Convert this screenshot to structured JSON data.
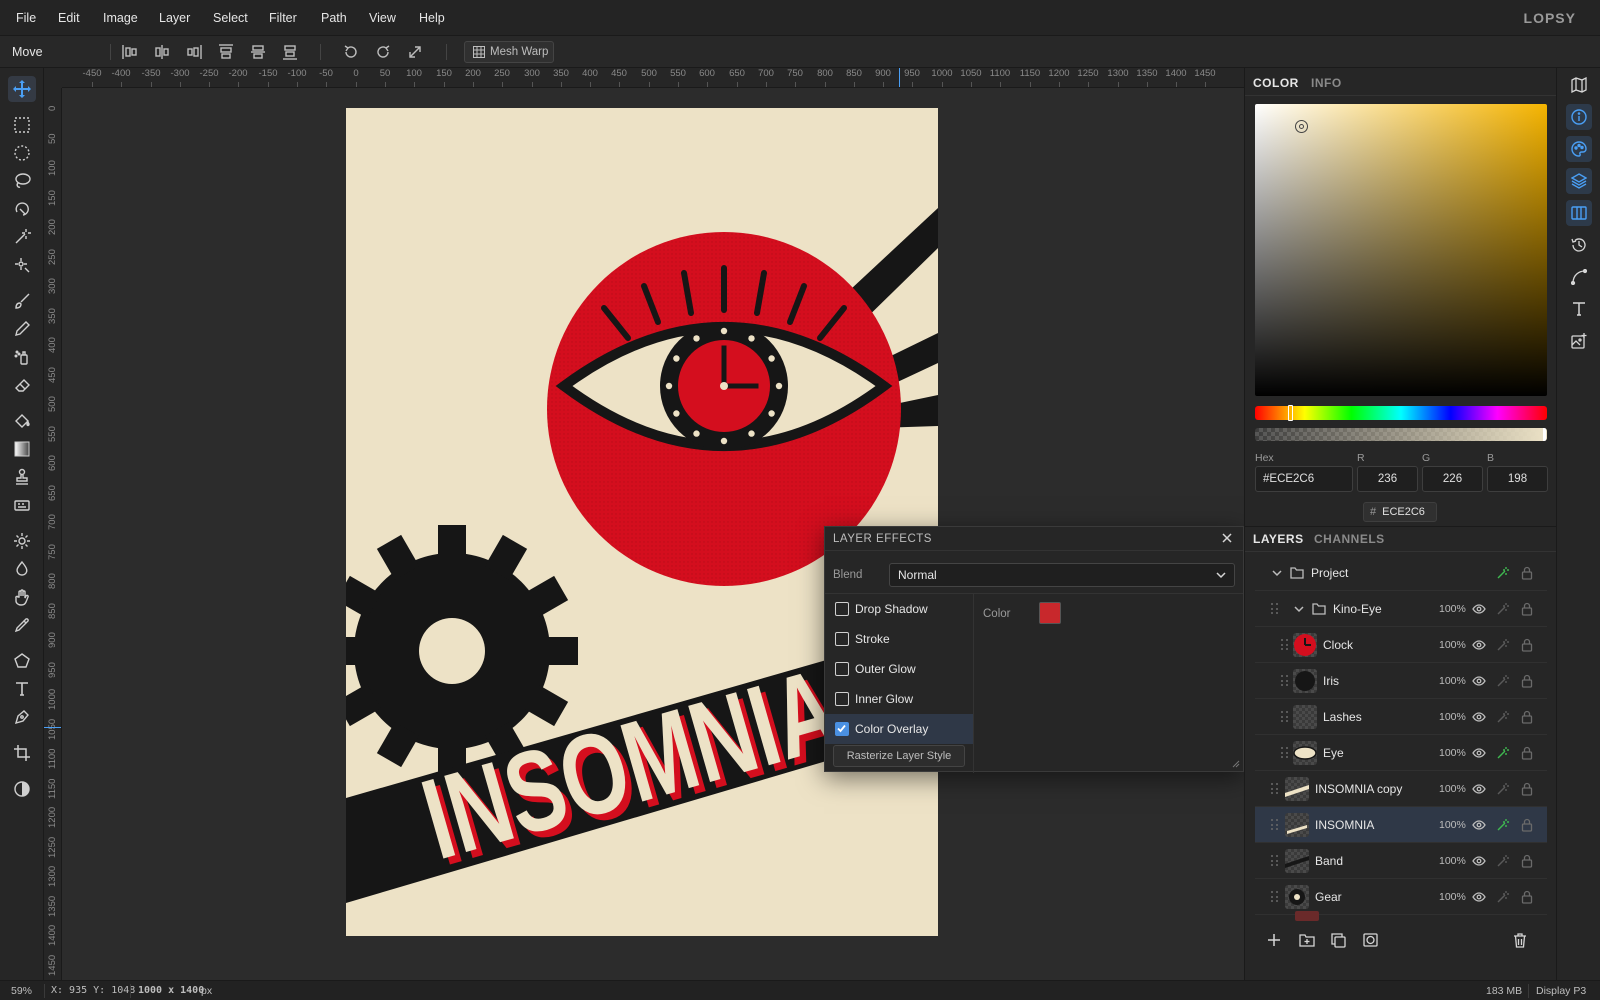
{
  "menubar": {
    "items": [
      "File",
      "Edit",
      "Image",
      "Layer",
      "Select",
      "Filter",
      "Path",
      "View",
      "Help"
    ],
    "brand": "LOPSY"
  },
  "options": {
    "tool_name": "Move",
    "mesh_warp_label": "Mesh Warp",
    "icons": [
      "align-left-icon",
      "align-center-h-icon",
      "align-right-icon",
      "align-top-icon",
      "align-middle-v-icon",
      "align-bottom-icon",
      "rotate-ccw-icon",
      "rotate-cw-icon",
      "expand-icon"
    ]
  },
  "rulers": {
    "horizontal": [
      "-450",
      "-400",
      "-350",
      "-300",
      "-250",
      "-200",
      "-150",
      "-100",
      "-50",
      "0",
      "50",
      "100",
      "150",
      "200",
      "250",
      "300",
      "350",
      "400",
      "450",
      "500",
      "550",
      "600",
      "650",
      "700",
      "750",
      "800",
      "850",
      "900",
      "950",
      "1000",
      "1050",
      "1100",
      "1150",
      "1200",
      "1250",
      "1300",
      "1350",
      "1400",
      "1450"
    ],
    "vertical": [
      "0",
      "50",
      "100",
      "150",
      "200",
      "250",
      "300",
      "350",
      "400",
      "450",
      "500",
      "550",
      "600",
      "650",
      "700",
      "750",
      "800",
      "850",
      "900",
      "950",
      "1000",
      "1050",
      "1100",
      "1150",
      "1200",
      "1250",
      "1300",
      "1350",
      "1400",
      "1450"
    ]
  },
  "toolbar": {
    "tools": [
      "move-tool",
      "rect-marquee-tool",
      "ellipse-marquee-tool",
      "lasso-tool",
      "magnetic-lasso-tool",
      "magic-wand-tool",
      "quick-select-tool",
      "brush-tool",
      "pencil-tool",
      "spray-tool",
      "eraser-tool",
      "fill-tool",
      "gradient-tool",
      "clone-stamp-tool",
      "pattern-tool",
      "dodge-tool",
      "burn-tool",
      "hand-tool",
      "eyedropper-tool",
      "polygon-tool",
      "text-tool",
      "pen-tool",
      "crop-tool",
      "contrast-tool"
    ],
    "active": "move-tool"
  },
  "artwork": {
    "banner_text": "INSOMNIA",
    "colors": {
      "paper": "#ede2c6",
      "red": "#d40e1e",
      "black": "#161616"
    }
  },
  "color_panel": {
    "tabs": [
      "COLOR",
      "INFO"
    ],
    "active_tab": "COLOR",
    "hex_label": "Hex",
    "r_label": "R",
    "g_label": "G",
    "b_label": "B",
    "hex": "#ECE2C6",
    "r": "236",
    "g": "226",
    "b": "198",
    "chip_hash": "#",
    "chip_value": "ECE2C6",
    "swatch_color": "#ECE2C6"
  },
  "layer_effects": {
    "title": "LAYER EFFECTS",
    "blend_label": "Blend",
    "blend_value": "Normal",
    "effects": [
      {
        "label": "Drop Shadow",
        "checked": false
      },
      {
        "label": "Stroke",
        "checked": false
      },
      {
        "label": "Outer Glow",
        "checked": false
      },
      {
        "label": "Inner Glow",
        "checked": false
      },
      {
        "label": "Color Overlay",
        "checked": true
      }
    ],
    "rasterize_label": "Rasterize Layer Style",
    "color_label": "Color",
    "overlay_color": "#c8282c"
  },
  "layers_panel": {
    "tabs": [
      "LAYERS",
      "CHANNELS"
    ],
    "active_tab": "LAYERS",
    "layers": [
      {
        "name": "Project",
        "type": "group",
        "level": 0,
        "opacity": "",
        "fx": true,
        "selected": false
      },
      {
        "name": "Kino-Eye",
        "type": "group",
        "level": 1,
        "opacity": "100%",
        "fx": false,
        "selected": false
      },
      {
        "name": "Clock",
        "type": "layer",
        "level": 2,
        "opacity": "100%",
        "fx": false,
        "selected": false
      },
      {
        "name": "Iris",
        "type": "layer",
        "level": 2,
        "opacity": "100%",
        "fx": false,
        "selected": false
      },
      {
        "name": "Lashes",
        "type": "layer",
        "level": 2,
        "opacity": "100%",
        "fx": false,
        "selected": false
      },
      {
        "name": "Eye",
        "type": "layer",
        "level": 2,
        "opacity": "100%",
        "fx": true,
        "selected": false
      },
      {
        "name": "INSOMNIA copy",
        "type": "layer",
        "level": 1,
        "opacity": "100%",
        "fx": false,
        "selected": false
      },
      {
        "name": "INSOMNIA",
        "type": "layer",
        "level": 1,
        "opacity": "100%",
        "fx": true,
        "selected": true
      },
      {
        "name": "Band",
        "type": "layer",
        "level": 1,
        "opacity": "100%",
        "fx": false,
        "selected": false
      },
      {
        "name": "Gear",
        "type": "layer",
        "level": 1,
        "opacity": "100%",
        "fx": false,
        "selected": false
      }
    ],
    "footer_icons": [
      "add-layer-icon",
      "add-group-icon",
      "duplicate-icon",
      "mask-icon",
      "trash-icon"
    ]
  },
  "status": {
    "zoom": "59%",
    "coords": "X: 935 Y: 1048",
    "dims_value": "1000 x 1400",
    "dims_unit": "px",
    "memory": "183 MB",
    "profile": "Display P3"
  }
}
